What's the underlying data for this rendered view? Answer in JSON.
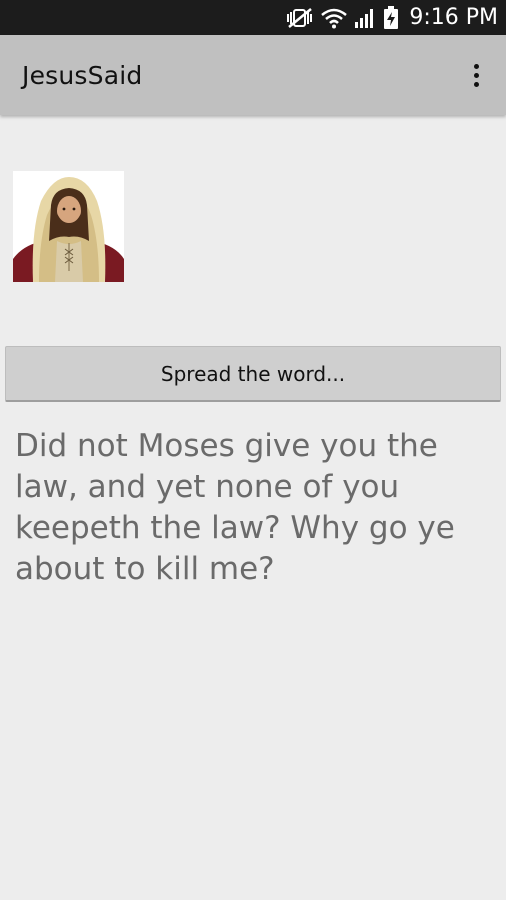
{
  "status_bar": {
    "time": "9:16 PM",
    "icons": [
      "mute-vibrate-icon",
      "wifi-icon",
      "cell-signal-icon",
      "battery-charging-icon"
    ]
  },
  "action_bar": {
    "title": "JesusSaid",
    "overflow_icon": "more-vert-icon"
  },
  "portrait": {
    "icon": "jesus-portrait-image"
  },
  "share_button": {
    "label": "Spread the word..."
  },
  "quote": {
    "text": "Did not Moses give you the law, and yet none of you keepeth the law? Why go ye about to kill me?"
  },
  "colors": {
    "status_bar_bg": "#1c1c1c",
    "action_bar_bg": "#c0c0c0",
    "page_bg": "#ededed",
    "button_bg": "#cfcfcf",
    "quote_text": "#6a6a6a"
  }
}
